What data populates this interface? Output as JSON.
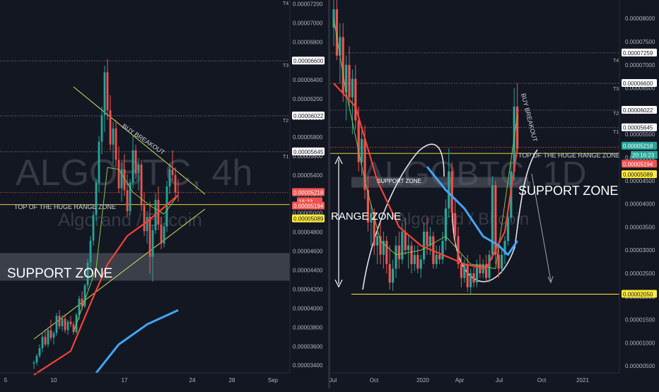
{
  "colors": {
    "background": "#131722",
    "panel_border": "#2a2e39",
    "grid_dotted": "#787b86",
    "up_candle": "#26a69a",
    "down_candle": "#ef5350",
    "trend_line": "#d4e157",
    "support_band": "#5d606b",
    "yellow_level": "#ffeb3b",
    "red_ma": "#f44336",
    "blue_ma": "#42a5f5",
    "green_ma": "#8bc34a",
    "watermark": "#363a45",
    "price_tag_red": "#ef5350",
    "price_tag_yellow": "#ffeb3b",
    "price_tag_teal": "#26a69a"
  },
  "left_panel": {
    "watermark_symbol": "ALGOBTC, 4h",
    "watermark_name": "Algorand / Bitcoin",
    "annotations": {
      "buy_breakout": "BUY BREAKOUT",
      "range_top": "TOP OF THE HUGE RANGE ZONE",
      "support_zone": "SUPPORT ZONE"
    },
    "target_labels": [
      "T4",
      "T3",
      "T2",
      "T1"
    ],
    "axis_ticks": [
      "0.00007200",
      "0.00007000",
      "0.00006800",
      "0.00006600",
      "0.00006400",
      "0.00006200",
      "0.00006000",
      "0.00005800",
      "0.00005600",
      "0.00005400",
      "0.00005200",
      "0.00005000",
      "0.00004800",
      "0.00004600",
      "0.00004400",
      "0.00004200",
      "0.00004000",
      "0.00003800",
      "0.00003600",
      "0.00003400"
    ],
    "level_tags": {
      "t3": "0.00006600",
      "t2": "0.00006022",
      "t1": "0.00005645",
      "last_price": "0.00005218",
      "countdown": "16:23",
      "ma_red": "0.00005194",
      "range_top": "0.00005089"
    },
    "x_ticks": [
      "5",
      "10",
      "17",
      "24",
      "28",
      "Sep"
    ]
  },
  "right_panel": {
    "watermark_symbol": "ALGOBTC, 1D",
    "watermark_name": "Algorand / Bitcoin",
    "annotations": {
      "buy_breakout": "BUY BREAKOUT",
      "range_top": "TOP OF THE HUGE RANGE ZONE",
      "support_zone_small": "SUPPORT ZONE",
      "support_zone_big": "SUPPORT ZONE",
      "range_zone": "RANGE ZONE"
    },
    "target_labels": [
      "T4",
      "T3",
      "T2",
      "T1"
    ],
    "axis_ticks": [
      "0.00008000",
      "0.00007500",
      "0.00007000",
      "0.00006500",
      "0.00006000",
      "0.00005500",
      "0.00005000",
      "0.00004500",
      "0.00004000",
      "0.00003500",
      "0.00003000",
      "0.00002500",
      "0.00002000",
      "0.00001500",
      "0.00001000",
      "0.00000500"
    ],
    "level_tags": {
      "t4": "0.00007259",
      "t3": "0.00006600",
      "t2": "0.00006022",
      "t1": "0.00005645",
      "last_price": "0.00005218",
      "countdown": "20:16:23",
      "ma_red": "0.00005194",
      "range_top": "0.00005089",
      "support_bottom": "0.00002050"
    },
    "x_ticks": [
      "Jul",
      "Oct",
      "2020",
      "Apr",
      "Jul",
      "Oct",
      "2021"
    ]
  },
  "chart_data": [
    {
      "type": "candlestick",
      "title": "ALGOBTC, 4h",
      "subtitle": "Algorand / Bitcoin",
      "x_ticks": [
        "5",
        "10",
        "17",
        "24",
        "28",
        "Sep"
      ],
      "ylim": [
        3.32e-05,
        7.24e-05
      ],
      "horizontal_levels": {
        "T3": 6.6e-05,
        "T2": 6.022e-05,
        "T1": 5.645e-05,
        "last": 5.218e-05,
        "ma_red": 5.194e-05,
        "range_top": 5.089e-05
      },
      "support_zone": [
        4.29e-05,
        4.58e-05
      ],
      "candles": [
        [
          3.42e-05,
          3.45e-05,
          3.36e-05,
          3.43e-05
        ],
        [
          3.43e-05,
          3.52e-05,
          3.4e-05,
          3.5e-05
        ],
        [
          3.5e-05,
          3.62e-05,
          3.48e-05,
          3.58e-05
        ],
        [
          3.58e-05,
          3.75e-05,
          3.54e-05,
          3.7e-05
        ],
        [
          3.7e-05,
          3.78e-05,
          3.6e-05,
          3.62e-05
        ],
        [
          3.62e-05,
          3.8e-05,
          3.59e-05,
          3.77e-05
        ],
        [
          3.77e-05,
          3.88e-05,
          3.66e-05,
          3.69e-05
        ],
        [
          3.69e-05,
          3.76e-05,
          3.62e-05,
          3.74e-05
        ],
        [
          3.74e-05,
          3.95e-05,
          3.71e-05,
          3.92e-05
        ],
        [
          3.92e-05,
          3.98e-05,
          3.78e-05,
          3.81e-05
        ],
        [
          3.81e-05,
          3.93e-05,
          3.76e-05,
          3.89e-05
        ],
        [
          3.89e-05,
          3.94e-05,
          3.74e-05,
          3.77e-05
        ],
        [
          3.77e-05,
          3.88e-05,
          3.72e-05,
          3.86e-05
        ],
        [
          3.86e-05,
          3.92e-05,
          3.8e-05,
          3.83e-05
        ],
        [
          3.83e-05,
          3.86e-05,
          3.72e-05,
          3.75e-05
        ],
        [
          3.75e-05,
          3.95e-05,
          3.73e-05,
          3.93e-05
        ],
        [
          3.93e-05,
          4.13e-05,
          3.88e-05,
          4.1e-05
        ],
        [
          4.1e-05,
          4.18e-05,
          3.98e-05,
          4.02e-05
        ],
        [
          4.02e-05,
          4.26e-05,
          4e-05,
          4.24e-05
        ],
        [
          4.24e-05,
          4.52e-05,
          4.2e-05,
          4.48e-05
        ],
        [
          4.48e-05,
          4.76e-05,
          4.42e-05,
          4.71e-05
        ],
        [
          4.71e-05,
          5.02e-05,
          4.66e-05,
          4.98e-05
        ],
        [
          4.98e-05,
          5.36e-05,
          4.92e-05,
          5.32e-05
        ],
        [
          5.32e-05,
          5.81e-05,
          5.22e-05,
          5.75e-05
        ],
        [
          5.75e-05,
          6.12e-05,
          5.62e-05,
          6.03e-05
        ],
        [
          6.03e-05,
          6.55e-05,
          5.85e-05,
          6.48e-05
        ],
        [
          6.48e-05,
          6.62e-05,
          5.98e-05,
          6.08e-05
        ],
        [
          6.08e-05,
          6.24e-05,
          5.66e-05,
          5.72e-05
        ],
        [
          5.72e-05,
          5.96e-05,
          5.52e-05,
          5.89e-05
        ],
        [
          5.89e-05,
          5.98e-05,
          5.48e-05,
          5.56e-05
        ],
        [
          5.56e-05,
          5.7e-05,
          5.21e-05,
          5.26e-05
        ],
        [
          5.26e-05,
          5.53e-05,
          5.12e-05,
          5.46e-05
        ],
        [
          5.46e-05,
          5.62e-05,
          5.18e-05,
          5.24e-05
        ],
        [
          5.24e-05,
          5.41e-05,
          4.96e-05,
          5.02e-05
        ],
        [
          5.02e-05,
          5.36e-05,
          4.98e-05,
          5.32e-05
        ],
        [
          5.32e-05,
          5.81e-05,
          5.26e-05,
          5.66e-05
        ],
        [
          5.66e-05,
          5.72e-05,
          5.36e-05,
          5.42e-05
        ],
        [
          5.42e-05,
          5.58e-05,
          5.24e-05,
          5.51e-05
        ],
        [
          5.51e-05,
          5.56e-05,
          5.02e-05,
          5.08e-05
        ],
        [
          5.08e-05,
          5.22e-05,
          4.76e-05,
          4.81e-05
        ],
        [
          4.81e-05,
          5.02e-05,
          4.68e-05,
          4.96e-05
        ],
        [
          4.96e-05,
          5.12e-05,
          4.36e-05,
          4.54e-05
        ],
        [
          4.54e-05,
          4.88e-05,
          4.28e-05,
          4.82e-05
        ],
        [
          4.82e-05,
          5.21e-05,
          4.78e-05,
          5.14e-05
        ],
        [
          5.14e-05,
          5.28e-05,
          4.82e-05,
          4.88e-05
        ],
        [
          4.88e-05,
          4.96e-05,
          4.62e-05,
          4.68e-05
        ],
        [
          4.68e-05,
          4.9e-05,
          4.64e-05,
          4.86e-05
        ],
        [
          4.86e-05,
          5.34e-05,
          4.8e-05,
          5.28e-05
        ],
        [
          5.28e-05,
          5.52e-05,
          5.2e-05,
          5.46e-05
        ],
        [
          5.46e-05,
          5.66e-05,
          5.34e-05,
          5.4e-05
        ],
        [
          5.4e-05,
          5.48e-05,
          5.16e-05,
          5.22e-05
        ],
        [
          5.22e-05,
          5.36e-05,
          5.12e-05,
          5.21e-05
        ]
      ],
      "ma_red": [
        [
          0,
          3.3e-05
        ],
        [
          13,
          3.55e-05
        ],
        [
          20,
          4.05e-05
        ],
        [
          26,
          4.46e-05
        ],
        [
          33,
          4.76e-05
        ],
        [
          40,
          4.91e-05
        ],
        [
          46,
          5.06e-05
        ],
        [
          51,
          5.19e-05
        ]
      ],
      "ma_blue": [
        [
          22,
          3.32e-05
        ],
        [
          30,
          3.62e-05
        ],
        [
          40,
          3.83e-05
        ],
        [
          51,
          3.98e-05
        ]
      ],
      "ma_green": [
        [
          14,
          3.75e-05
        ],
        [
          22,
          4.42e-05
        ],
        [
          26,
          5.48e-05
        ],
        [
          30,
          5.46e-05
        ],
        [
          35,
          5.22e-05
        ],
        [
          41,
          5.08e-05
        ],
        [
          46,
          4.99e-05
        ],
        [
          51,
          5.19e-05
        ]
      ]
    },
    {
      "type": "candlestick",
      "title": "ALGOBTC, 1D",
      "subtitle": "Algorand / Bitcoin",
      "x_ticks": [
        "Jul",
        "Oct",
        "2020",
        "Apr",
        "Jul",
        "Oct",
        "2021"
      ],
      "ylim": [
        3.5e-06,
        8.4e-05
      ],
      "horizontal_levels": {
        "T4": 7.259e-05,
        "T3": 6.6e-05,
        "T2": 6.022e-05,
        "T1": 5.645e-05,
        "last": 5.218e-05,
        "ma_red": 5.194e-05,
        "range_top": 5.089e-05,
        "support_bottom": 2.05e-05
      },
      "support_zone": [
        4.35e-05,
        4.58e-05
      ],
      "candles": [
        [
          7.8e-05,
          8.6e-05,
          7.4e-05,
          8.2e-05
        ],
        [
          8.2e-05,
          8.5e-05,
          7.1e-05,
          7.2e-05
        ],
        [
          7.2e-05,
          7.9e-05,
          6.6e-05,
          7.6e-05
        ],
        [
          7.6e-05,
          7.9e-05,
          6.2e-05,
          6.4e-05
        ],
        [
          6.4e-05,
          7.2e-05,
          5.8e-05,
          7e-05
        ],
        [
          7e-05,
          7.4e-05,
          6.1e-05,
          6.3e-05
        ],
        [
          6.3e-05,
          6.9e-05,
          5.5e-05,
          6.7e-05
        ],
        [
          6.7e-05,
          7e-05,
          5.6e-05,
          5.8e-05
        ],
        [
          5.8e-05,
          6.1e-05,
          4.7e-05,
          4.9e-05
        ],
        [
          4.9e-05,
          5.6e-05,
          4.6e-05,
          5.4e-05
        ],
        [
          5.4e-05,
          5.7e-05,
          4.1e-05,
          4.3e-05
        ],
        [
          4.3e-05,
          4.6e-05,
          3.4e-05,
          3.6e-05
        ],
        [
          3.6e-05,
          4e-05,
          3.1e-05,
          3.8e-05
        ],
        [
          3.8e-05,
          3.9e-05,
          2.9e-05,
          3.1e-05
        ],
        [
          3.1e-05,
          3.5e-05,
          2.7e-05,
          3.3e-05
        ],
        [
          3.3e-05,
          3.6e-05,
          2.7e-05,
          2.9e-05
        ],
        [
          2.9e-05,
          3.4e-05,
          2.6e-05,
          3.2e-05
        ],
        [
          3.2e-05,
          3.3e-05,
          2.5e-05,
          2.7e-05
        ],
        [
          2.7e-05,
          3.1e-05,
          2.15e-05,
          2.3e-05
        ],
        [
          2.3e-05,
          2.8e-05,
          2.12e-05,
          2.6e-05
        ],
        [
          2.6e-05,
          3.3e-05,
          2.4e-05,
          3.1e-05
        ],
        [
          3.1e-05,
          3.4e-05,
          2.6e-05,
          2.8e-05
        ],
        [
          2.8e-05,
          3.6e-05,
          2.7e-05,
          3.4e-05
        ],
        [
          3.4e-05,
          3.7e-05,
          2.9e-05,
          3e-05
        ],
        [
          3e-05,
          3.3e-05,
          2.6e-05,
          3.1e-05
        ],
        [
          3.1e-05,
          3.2e-05,
          2.5e-05,
          2.7e-05
        ],
        [
          2.7e-05,
          3.1e-05,
          2.55e-05,
          2.9e-05
        ],
        [
          2.9e-05,
          3.1e-05,
          2.5e-05,
          2.6e-05
        ],
        [
          2.6e-05,
          2.9e-05,
          2.4e-05,
          2.8e-05
        ],
        [
          2.8e-05,
          3.6e-05,
          2.7e-05,
          3.4e-05
        ],
        [
          3.4e-05,
          3.7e-05,
          2.9e-05,
          3.1e-05
        ],
        [
          3.1e-05,
          3.5e-05,
          2.9e-05,
          3.3e-05
        ],
        [
          3.3e-05,
          3.4e-05,
          2.6e-05,
          2.7e-05
        ],
        [
          2.7e-05,
          3.1e-05,
          2.6e-05,
          2.9e-05
        ],
        [
          2.9e-05,
          3.1e-05,
          2.7e-05,
          2.8e-05
        ],
        [
          2.8e-05,
          3.4e-05,
          2.7e-05,
          3.2e-05
        ],
        [
          3.2e-05,
          4.1e-05,
          3e-05,
          3.9e-05
        ],
        [
          3.9e-05,
          5.2e-05,
          3.7e-05,
          4.7e-05
        ],
        [
          4.7e-05,
          4.9e-05,
          3.6e-05,
          3.8e-05
        ],
        [
          3.8e-05,
          4.1e-05,
          3.1e-05,
          3.3e-05
        ],
        [
          3.3e-05,
          3.5e-05,
          2.6e-05,
          2.7e-05
        ],
        [
          2.7e-05,
          2.9e-05,
          2.2e-05,
          2.4e-05
        ],
        [
          2.4e-05,
          2.8e-05,
          2.3e-05,
          2.7e-05
        ],
        [
          2.7e-05,
          2.9e-05,
          2.1e-05,
          2.2e-05
        ],
        [
          2.2e-05,
          2.6e-05,
          2.05e-05,
          2.5e-05
        ],
        [
          2.5e-05,
          2.7e-05,
          2.2e-05,
          2.3e-05
        ],
        [
          2.3e-05,
          2.8e-05,
          2.2e-05,
          2.7e-05
        ],
        [
          2.7e-05,
          2.9e-05,
          2.4e-05,
          2.5e-05
        ],
        [
          2.5e-05,
          2.8e-05,
          2.4e-05,
          2.7e-05
        ],
        [
          2.7e-05,
          2.9e-05,
          2.3e-05,
          2.4e-05
        ],
        [
          2.4e-05,
          3e-05,
          2.3e-05,
          2.9e-05
        ],
        [
          2.9e-05,
          4.6e-05,
          2.8e-05,
          4.4e-05
        ],
        [
          4.4e-05,
          4.5e-05,
          2.7e-05,
          2.9e-05
        ],
        [
          2.9e-05,
          3.2e-05,
          2.4e-05,
          2.6e-05
        ],
        [
          2.6e-05,
          3e-05,
          2.5e-05,
          2.9e-05
        ],
        [
          2.9e-05,
          3.3e-05,
          2.7e-05,
          3.2e-05
        ],
        [
          3.2e-05,
          3.9e-05,
          3.1e-05,
          3.7e-05
        ],
        [
          3.7e-05,
          4.9e-05,
          3.6e-05,
          4.7e-05
        ],
        [
          4.7e-05,
          6.5e-05,
          4.5e-05,
          6.1e-05
        ],
        [
          6.1e-05,
          6.6e-05,
          5.1e-05,
          5.2e-05
        ]
      ],
      "ma_red": [
        [
          0,
          6.6e-05
        ],
        [
          7,
          6.1e-05
        ],
        [
          14,
          4.5e-05
        ],
        [
          21,
          3.5e-05
        ],
        [
          28,
          3.1e-05
        ],
        [
          35,
          2.9e-05
        ],
        [
          42,
          2.7e-05
        ],
        [
          49,
          2.6e-05
        ],
        [
          55,
          3.4e-05
        ],
        [
          59,
          5.2e-05
        ]
      ],
      "ma_green": [
        [
          0,
          8e-05
        ],
        [
          4,
          6.4e-05
        ],
        [
          10,
          4.5e-05
        ],
        [
          15,
          3.2e-05
        ],
        [
          20,
          2.9e-05
        ],
        [
          28,
          3e-05
        ],
        [
          36,
          3.3e-05
        ],
        [
          44,
          2.7e-05
        ],
        [
          52,
          2.6e-05
        ],
        [
          59,
          5.9e-05
        ]
      ],
      "ma_blue": [
        [
          30,
          4.8e-05
        ],
        [
          36,
          4.3e-05
        ],
        [
          42,
          3.9e-05
        ],
        [
          48,
          3.3e-05
        ],
        [
          53,
          3.1e-05
        ],
        [
          56,
          2.9e-05
        ],
        [
          59,
          3.2e-05
        ]
      ]
    }
  ]
}
